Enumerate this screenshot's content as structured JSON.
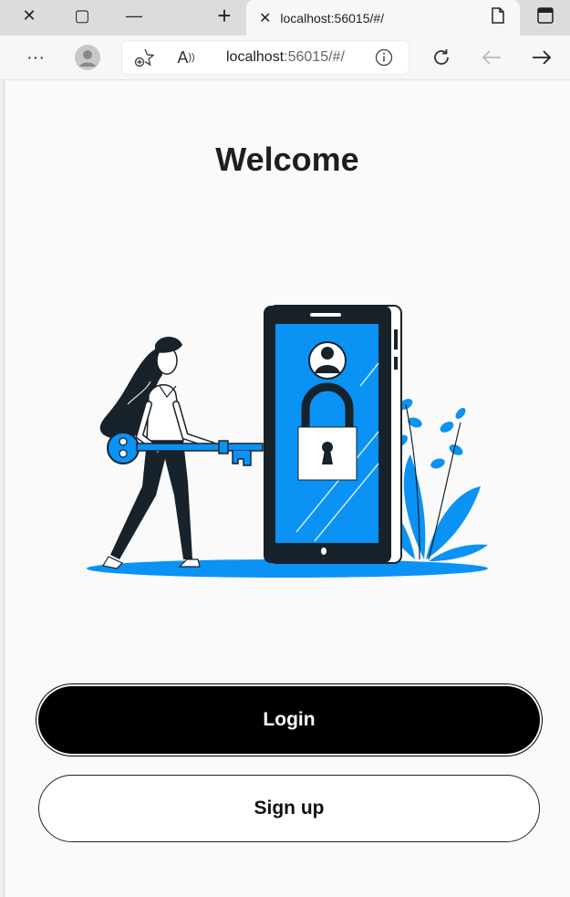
{
  "browser": {
    "tab_title": "localhost:56015/#/",
    "url_host": "localhost",
    "url_rest": ":56015/#/"
  },
  "page": {
    "title": "Welcome",
    "login_label": "Login",
    "signup_label": "Sign up"
  },
  "colors": {
    "accent": "#0a92f5",
    "dark": "#17222a"
  }
}
